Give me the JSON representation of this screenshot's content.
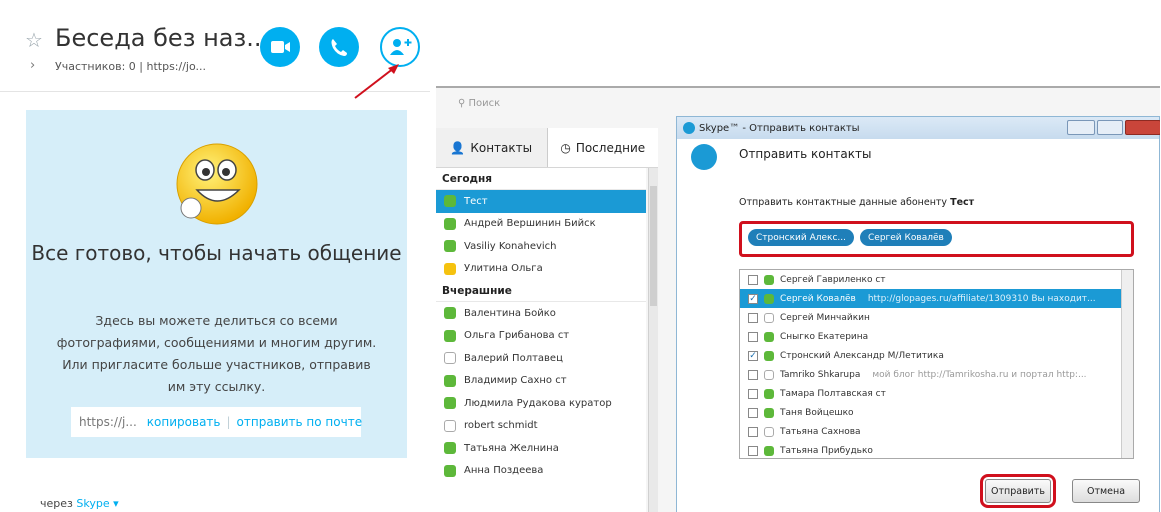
{
  "header": {
    "title": "Беседа без наз...",
    "subtitle": "Участников: 0 | https://jo...",
    "chevron": "›",
    "star": "☆"
  },
  "card": {
    "ready_title": "Все готово, чтобы начать общение",
    "description": "Здесь вы можете делиться со всеми фотографиями, сообщениями и многим другим. Или пригласите больше участников, отправив им эту ссылку.",
    "link": "https://j...",
    "copy_label": "копировать",
    "sep": "|",
    "email_label": "отправить по почте"
  },
  "footer": {
    "via": "через",
    "skype": "Skype ▾"
  },
  "colors": {
    "accent": "#00aff0",
    "card_bg": "#d6eef9",
    "highlight_red": "#d0101d",
    "selected_row": "#1b9ad5"
  },
  "contacts_panel": {
    "search_placeholder": "Поиск",
    "tab_contacts": "Контакты",
    "tab_recent": "Последние",
    "section_today": "Сегодня",
    "section_yesterday": "Вчерашние",
    "today": [
      {
        "name": "Тест",
        "status": "selected"
      },
      {
        "name": "Андрей Вершинин Бийск",
        "status": "online"
      },
      {
        "name": "Vasiliy Konahevich",
        "status": "online"
      },
      {
        "name": "Улитина Ольга",
        "status": "away"
      }
    ],
    "yesterday": [
      {
        "name": "Валентина Бойко",
        "status": "online"
      },
      {
        "name": "Ольга Грибанова ст",
        "status": "online"
      },
      {
        "name": "Валерий Полтавец",
        "status": "offline"
      },
      {
        "name": "Владимир Сахно ст",
        "status": "online"
      },
      {
        "name": "Людмила Рудакова куратор",
        "status": "online"
      },
      {
        "name": "robert schmidt",
        "status": "offline"
      },
      {
        "name": "Татьяна Желнина",
        "status": "online"
      },
      {
        "name": "Анна Поздеева",
        "status": "online"
      }
    ]
  },
  "dialog": {
    "window_title": "Skype™ - Отправить контакты",
    "heading": "Отправить контакты",
    "instruction": "Отправить контактные данные абоненту",
    "recipient": "Тест",
    "tags": [
      "Стронский Алекс...",
      "Сергей Ковалёв"
    ],
    "contacts": [
      {
        "name": "Сергей Гавриленко ст",
        "checked": false,
        "selected": false,
        "note": ""
      },
      {
        "name": "Сергей Ковалёв",
        "checked": true,
        "selected": true,
        "note": "http://glopages.ru/affiliate/1309310 Вы находит..."
      },
      {
        "name": "Сергей Минчайкин",
        "checked": false,
        "selected": false,
        "note": ""
      },
      {
        "name": "Сныгко Екатерина",
        "checked": false,
        "selected": false,
        "note": ""
      },
      {
        "name": "Стронский Александр M/Летитика",
        "checked": true,
        "selected": false,
        "note": ""
      },
      {
        "name": "Tamriko Shkarupa",
        "checked": false,
        "selected": false,
        "note": "мой блог http://Tamrikosha.ru   и портал http:..."
      },
      {
        "name": "Тамара Полтавская ст",
        "checked": false,
        "selected": false,
        "note": ""
      },
      {
        "name": "Таня Войцешко",
        "checked": false,
        "selected": false,
        "note": ""
      },
      {
        "name": "Татьяна Сахнова",
        "checked": false,
        "selected": false,
        "note": ""
      },
      {
        "name": "Татьяна Прибудько",
        "checked": false,
        "selected": false,
        "note": ""
      }
    ],
    "send_label": "Отправить",
    "cancel_label": "Отмена"
  }
}
